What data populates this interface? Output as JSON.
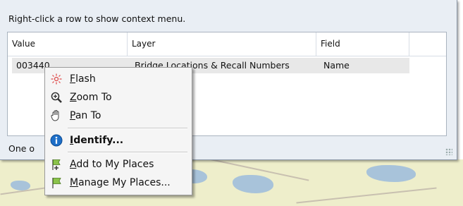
{
  "instruction": "Right-click a row to show context menu.",
  "table": {
    "columns": [
      "Value",
      "Layer",
      "Field"
    ],
    "rows": [
      {
        "value": "003440",
        "layer": "Bridge Locations & Recall Numbers",
        "field": "Name"
      }
    ]
  },
  "status_text": "One o",
  "context_menu": {
    "items": [
      {
        "key": "F",
        "rest": "lash",
        "icon": "flash-icon"
      },
      {
        "key": "Z",
        "rest": "oom To",
        "icon": "zoom-in-icon"
      },
      {
        "key": "P",
        "rest": "an To",
        "icon": "hand-pan-icon"
      },
      {
        "key": "I",
        "rest": "dentify...",
        "icon": "info-icon"
      },
      {
        "key": "A",
        "rest": "dd to My Places",
        "icon": "flag-add-icon"
      },
      {
        "key": "M",
        "rest": "anage My Places...",
        "icon": "flag-icon"
      }
    ]
  },
  "colors": {
    "row_highlight": "#e8e8e8",
    "map_land": "#eeeecb",
    "map_water": "#a8c3da",
    "info_blue": "#1e6fc8"
  }
}
